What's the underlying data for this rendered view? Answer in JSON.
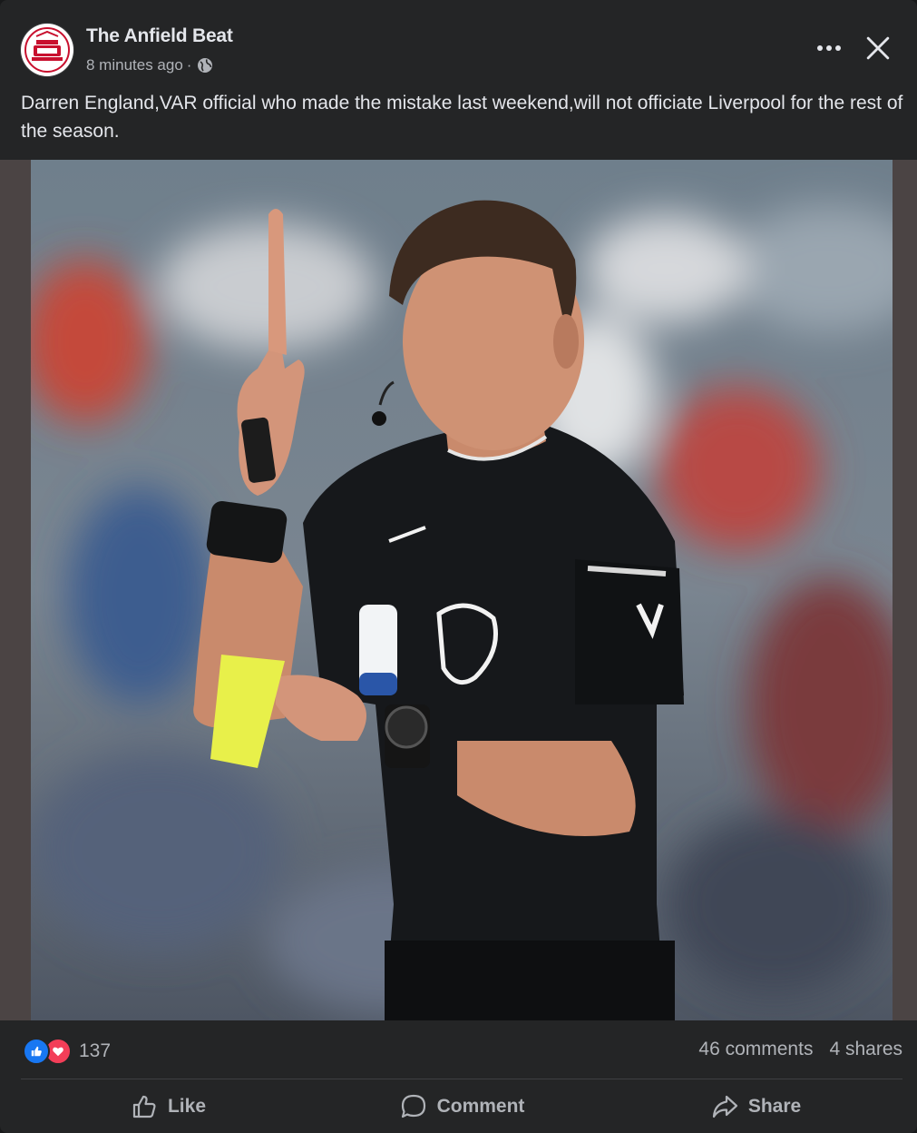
{
  "post": {
    "page_name": "The Anfield Beat",
    "timestamp": "8 minutes ago",
    "separator": "·",
    "audience_icon": "globe-icon",
    "caption": "Darren England,VAR official who made the mistake last weekend,will not officiate Liverpool for the rest of the season.",
    "more_icon": "more-options-icon",
    "close_icon": "close-icon"
  },
  "reactions": {
    "icons": [
      "like-reaction-icon",
      "love-reaction-icon"
    ],
    "count": "137",
    "like_color": "#1877f2",
    "love_color": "#f33e58"
  },
  "engagement": {
    "comments": "46 comments",
    "shares": "4 shares"
  },
  "actions": {
    "like": {
      "label": "Like",
      "icon": "thumbs-up-icon"
    },
    "comment": {
      "label": "Comment",
      "icon": "comment-icon"
    },
    "share": {
      "label": "Share",
      "icon": "share-arrow-icon"
    }
  },
  "theme": {
    "background": "#18191a",
    "card": "#242526",
    "primary_text": "#e4e6eb",
    "secondary_text": "#b0b3b8"
  }
}
